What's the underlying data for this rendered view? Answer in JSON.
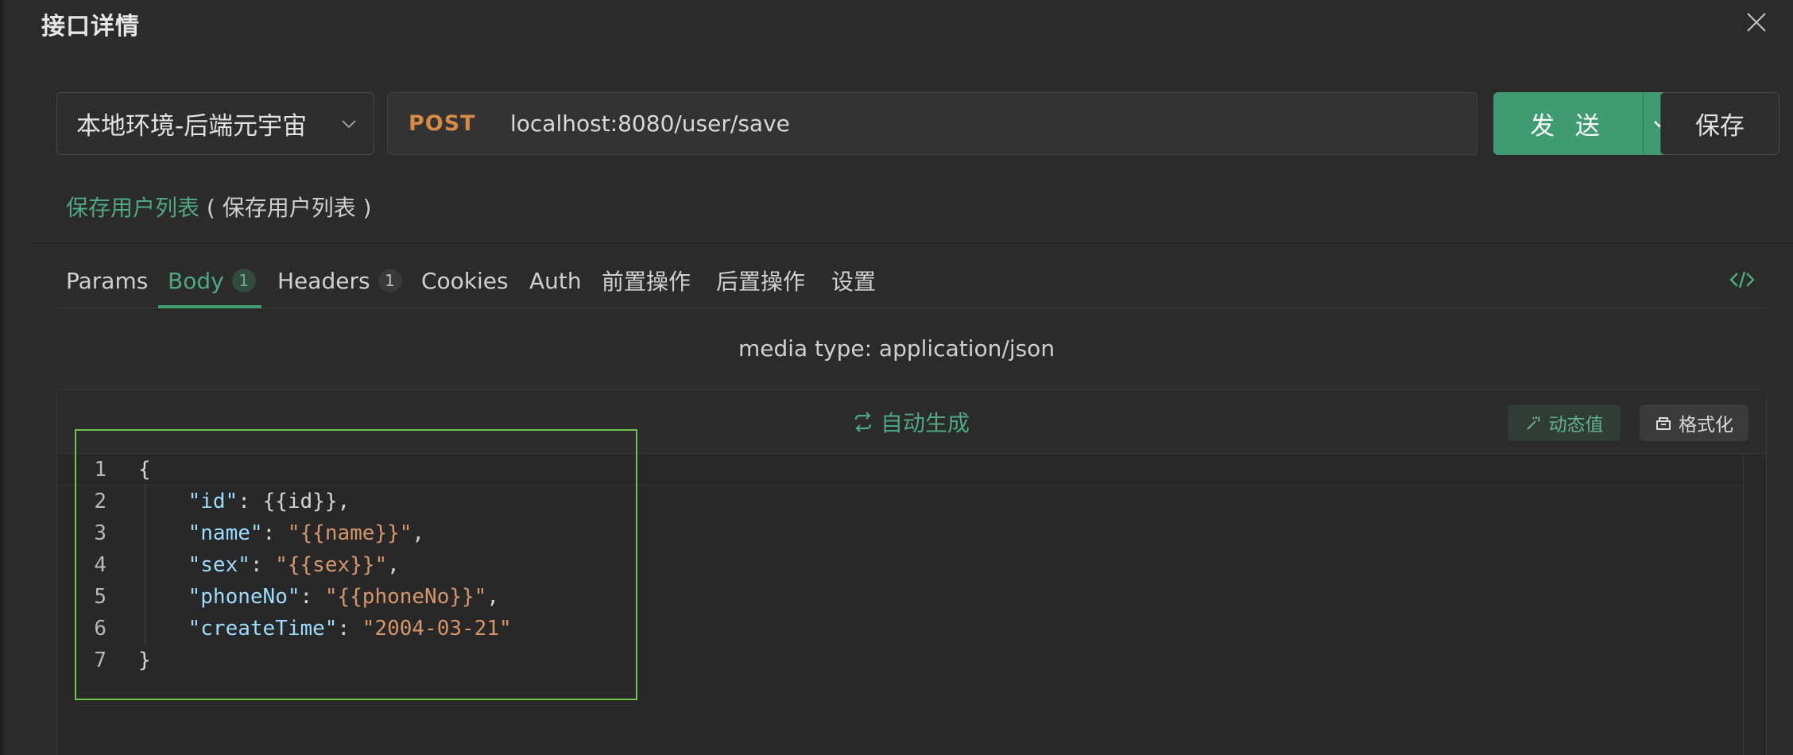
{
  "dialog": {
    "title": "接口详情"
  },
  "request": {
    "environment": "本地环境-后端元宇宙",
    "method": "POST",
    "url": "localhost:8080/user/save",
    "send_label": "发 送",
    "save_label": "保存"
  },
  "api": {
    "name": "保存用户列表",
    "description": "( 保存用户列表 )"
  },
  "tabs": [
    {
      "label": "Params"
    },
    {
      "label": "Body",
      "badge": "1",
      "active": true
    },
    {
      "label": "Headers",
      "badge": "1"
    },
    {
      "label": "Cookies"
    },
    {
      "label": "Auth"
    },
    {
      "label": "前置操作"
    },
    {
      "label": "后置操作"
    },
    {
      "label": "设置"
    }
  ],
  "body": {
    "media_type": "media type: application/json",
    "auto_generate": "自动生成",
    "dynamic_value": "动态值",
    "format": "格式化",
    "lines": [
      {
        "n": "1",
        "text": "{"
      },
      {
        "n": "2",
        "key": "\"id\"",
        "sep": ": ",
        "val": "{{id}}",
        "val_is_str": false,
        "tail": ","
      },
      {
        "n": "3",
        "key": "\"name\"",
        "sep": ": ",
        "val": "\"{{name}}\"",
        "val_is_str": true,
        "tail": ","
      },
      {
        "n": "4",
        "key": "\"sex\"",
        "sep": ": ",
        "val": "\"{{sex}}\"",
        "val_is_str": true,
        "tail": ","
      },
      {
        "n": "5",
        "key": "\"phoneNo\"",
        "sep": ": ",
        "val": "\"{{phoneNo}}\"",
        "val_is_str": true,
        "tail": ","
      },
      {
        "n": "6",
        "key": "\"createTime\"",
        "sep": ": ",
        "val": "\"2004-03-21\"",
        "val_is_str": true,
        "tail": ""
      },
      {
        "n": "7",
        "text": "}"
      }
    ]
  },
  "colors": {
    "accent": "#3f9c72",
    "method_post": "#d58a45",
    "json_key": "#9cdcfe",
    "json_string": "#d7956a",
    "annotation_box": "#6cc24a"
  },
  "icons": [
    "close-icon",
    "chevron-down-icon",
    "code-icon",
    "refresh-icon",
    "magic-wand-icon",
    "format-icon"
  ]
}
